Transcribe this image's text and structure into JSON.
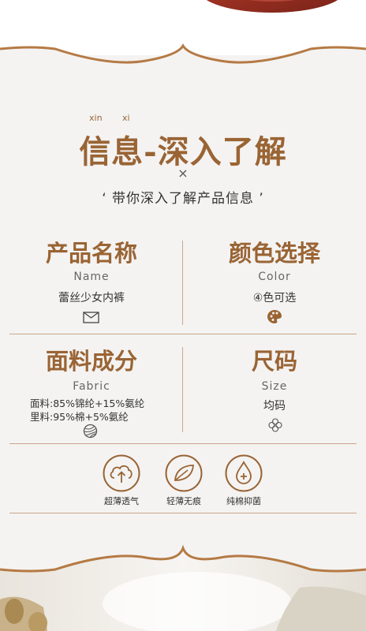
{
  "header": {
    "pinyin": [
      "xin",
      "xi"
    ],
    "title": "信息-深入了解",
    "times_symbol": "×",
    "subtitle": "‘ 带你深入了解产品信息 ’"
  },
  "product_name": {
    "title": "产品名称",
    "en": "Name",
    "value": "蕾丝少女内裤",
    "icon": "envelope-icon"
  },
  "color": {
    "title": "颜色选择",
    "en": "Color",
    "value": "④色可选",
    "icon": "palette-icon"
  },
  "fabric": {
    "title": "面料成分",
    "en": "Fabric",
    "lines": [
      "面料:85%锦纶+15%氨纶",
      "里料:95%棉+5%氨纶"
    ],
    "icon": "yarn-ball-icon"
  },
  "size": {
    "title": "尺码",
    "en": "Size",
    "value": "均码",
    "icon": "flower-icon"
  },
  "features": [
    {
      "label": "超薄透气",
      "icon": "cloud-upload-icon"
    },
    {
      "label": "轻薄无痕",
      "icon": "leaf-icon"
    },
    {
      "label": "纯棉抑菌",
      "icon": "water-drop-plus-icon"
    }
  ],
  "colors": {
    "accent": "#9a6434",
    "frame": "#b57a44",
    "line": "#caa58b",
    "background": "#f4f3f2"
  }
}
